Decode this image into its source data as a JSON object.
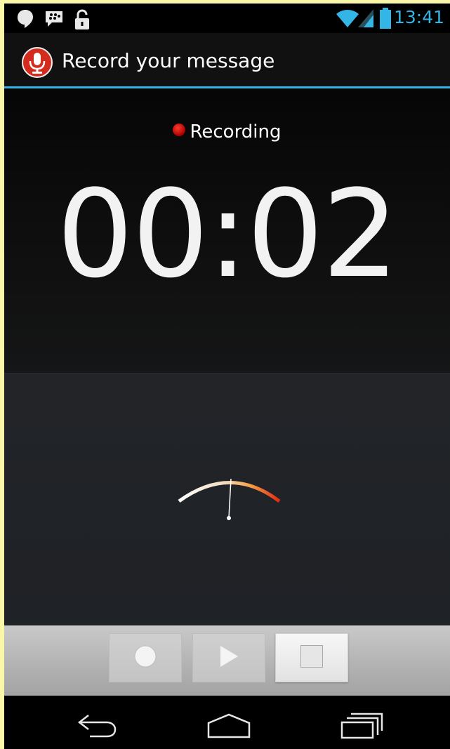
{
  "status_bar": {
    "time": "13:41",
    "left_icons": [
      "hangouts-icon",
      "blackberry-messenger-icon",
      "unlocked-icon"
    ],
    "right_icons": [
      "wifi-icon",
      "cell-signal-icon",
      "battery-icon"
    ],
    "accent_color": "#33b5e5"
  },
  "action_bar": {
    "title": "Record your message",
    "icon": "microphone-icon"
  },
  "recorder": {
    "status_label": "Recording",
    "status_color": "#cc0000",
    "timer": "00:02"
  },
  "meter": {
    "icon": "vu-meter",
    "level": 0.5
  },
  "controls": {
    "buttons": [
      {
        "name": "record-button",
        "icon": "record-icon",
        "active": false
      },
      {
        "name": "play-button",
        "icon": "play-icon",
        "active": false
      },
      {
        "name": "stop-button",
        "icon": "stop-icon",
        "active": true
      }
    ]
  },
  "nav_bar": {
    "buttons": [
      "back-icon",
      "home-icon",
      "recent-apps-icon"
    ]
  }
}
